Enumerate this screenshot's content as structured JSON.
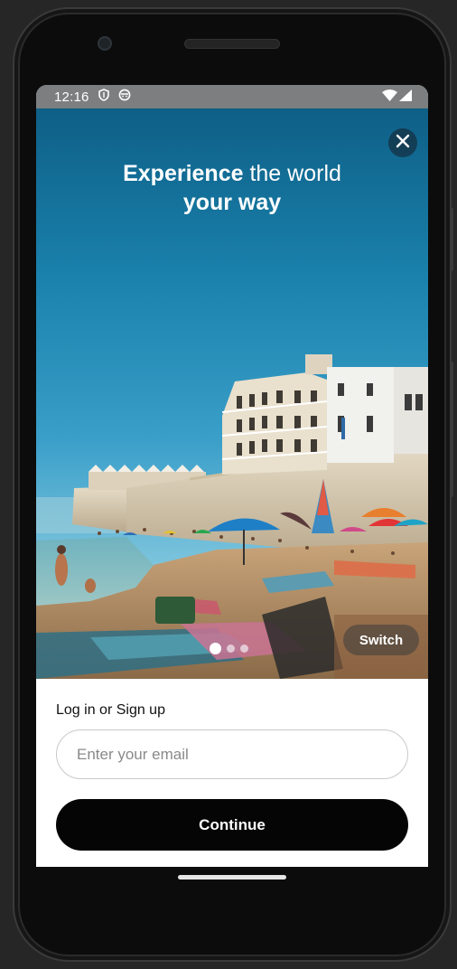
{
  "status_bar": {
    "time": "12:16",
    "icons": [
      "shield-icon",
      "face-icon",
      "wifi-icon",
      "signal-icon"
    ]
  },
  "hero": {
    "headline_bold_1": "Experience",
    "headline_regular": " the world",
    "headline_bold_2": "your way",
    "close_icon": "close-icon",
    "switch_label": "Switch",
    "carousel": {
      "total": 3,
      "active_index": 0
    }
  },
  "login": {
    "label": "Log in or Sign up",
    "email_placeholder": "Enter your email",
    "email_value": "",
    "continue_label": "Continue"
  },
  "colors": {
    "primary_button": "#050505",
    "status_bar": "#7c7e80",
    "sky": "#1a82ad"
  }
}
